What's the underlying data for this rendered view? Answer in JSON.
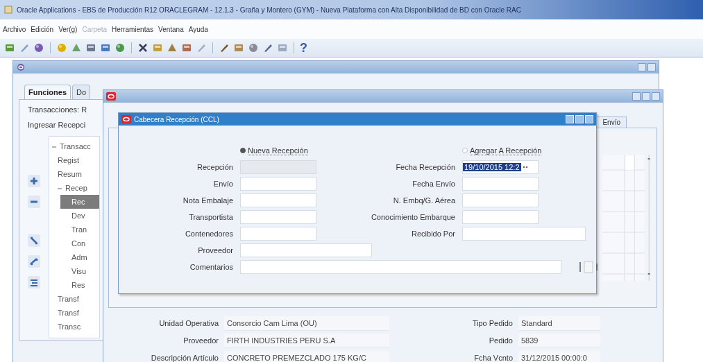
{
  "window": {
    "title": "Oracle Applications - EBS de Producción R12 ORACLEGRAM - 12.1.3 - Graña y Montero (GYM) - Nueva Plataforma con Alta Disponibilidad de BD con Oracle RAC"
  },
  "menu": [
    {
      "label": "Archivo",
      "disabled": false
    },
    {
      "label": "Edición",
      "disabled": false
    },
    {
      "label": "Ver(g)",
      "disabled": false
    },
    {
      "label": "Carpeta",
      "disabled": true
    },
    {
      "label": "Herramientas",
      "disabled": false
    },
    {
      "label": "Ventana",
      "disabled": false
    },
    {
      "label": "Ayuda",
      "disabled": false
    }
  ],
  "toolbar": {
    "help": "?"
  },
  "navigator": {
    "tabs": [
      {
        "label": "Funciones",
        "selected": true
      },
      {
        "label": "Do",
        "selected": false
      }
    ],
    "path": "Transacciones: R",
    "subtitle": "Ingresar Recepci",
    "tree": [
      {
        "label": "Transacc",
        "expanded": true,
        "selected": false,
        "children": [
          {
            "label": "Regist",
            "selected": false
          },
          {
            "label": "Resum",
            "selected": false
          },
          {
            "label": "Recep",
            "expanded": true,
            "selected": false,
            "children": [
              {
                "label": "Rec",
                "selected": true
              },
              {
                "label": "Dev",
                "selected": false
              },
              {
                "label": "Tran",
                "selected": false
              },
              {
                "label": "Con",
                "selected": false
              },
              {
                "label": "Adm",
                "selected": false
              },
              {
                "label": "Visu",
                "selected": false
              },
              {
                "label": "Res",
                "selected": false
              }
            ]
          },
          {
            "label": "Transf",
            "selected": false
          },
          {
            "label": "Transf",
            "selected": false
          },
          {
            "label": "Transc",
            "selected": false
          }
        ]
      }
    ]
  },
  "receipts_window": {
    "tabs": [
      {
        "label": "Envío",
        "selected": false
      }
    ],
    "info_left": [
      {
        "label": "Unidad Operativa",
        "value": "Consorcio Cam Lima (OU)"
      },
      {
        "label": "Proveedor",
        "value": "FIRTH INDUSTRIES PERU S.A"
      },
      {
        "label": "Descripción Artículo",
        "value": "CONCRETO PREMEZCLADO 175 KG/C"
      }
    ],
    "info_right": [
      {
        "label": "Tipo Pedido",
        "value": "Standard"
      },
      {
        "label": "Pedido",
        "value": "5839"
      },
      {
        "label": "Fcha Vcnto",
        "value": "31/12/2015 00:00:0"
      }
    ]
  },
  "dialog": {
    "title": "Cabecera Recepción (CCL)",
    "options": [
      {
        "label": "Nueva Recepción",
        "selected": true
      },
      {
        "label": "Agregar A Recepción",
        "selected": false
      }
    ],
    "left_fields": [
      {
        "label": "Recepción",
        "kind": "short",
        "disabled": true
      },
      {
        "label": "Envío",
        "kind": "short",
        "disabled": false
      },
      {
        "label": "Nota Embalaje",
        "kind": "short",
        "disabled": false
      },
      {
        "label": "Transportista",
        "kind": "short",
        "disabled": false
      },
      {
        "label": "Contenedores",
        "kind": "short",
        "disabled": false
      },
      {
        "label": "Proveedor",
        "kind": "wide",
        "disabled": false
      },
      {
        "label": "Comentarios",
        "kind": "full",
        "disabled": false
      }
    ],
    "right_fields": [
      {
        "label": "Fecha Recepción",
        "kind": "short",
        "value": "19/10/2015 12:2",
        "focused": true
      },
      {
        "label": "Fecha Envío",
        "kind": "short",
        "focused": false
      },
      {
        "label": "N. Embq/G. Aérea",
        "kind": "short",
        "focused": false
      },
      {
        "label": "Conocimiento Embarque",
        "kind": "short",
        "focused": false
      },
      {
        "label": "Recibido Por",
        "kind": "wide",
        "focused": false
      }
    ]
  }
}
